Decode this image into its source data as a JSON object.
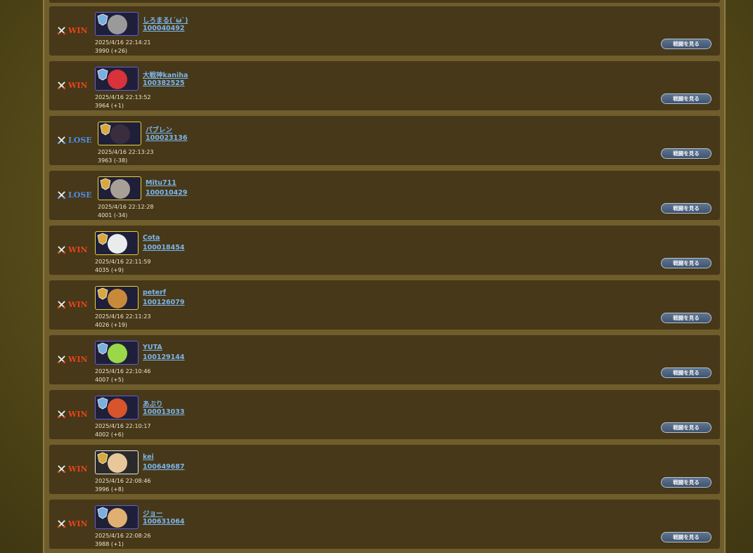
{
  "colors": {
    "win": "#e5431c",
    "lose": "#4f8fe8",
    "link": "#7cb5ec",
    "row_bg": "#463818"
  },
  "icons": {
    "result": "crossed-swords-icon",
    "rank": "rank-emblem-icon"
  },
  "battles": [
    {
      "result": "WIN",
      "name": "しろまる(´ω`)",
      "id": "100040492",
      "datetime": "2025/4/16 22:14:21",
      "rate": "3990 (+26)",
      "button": "戦闘を見る",
      "face_color": "#9a9a9a",
      "frame": "blue"
    },
    {
      "result": "WIN",
      "name": "大戦神kaniha",
      "id": "100382525",
      "datetime": "2025/4/16 22:13:52",
      "rate": "3964 (+1)",
      "button": "戦闘を見る",
      "face_color": "#d8323a",
      "frame": "blue"
    },
    {
      "result": "LOSE",
      "name": "パブレン",
      "id": "100023136",
      "datetime": "2025/4/16 22:13:23",
      "rate": "3963 (-38)",
      "button": "戦闘を見る",
      "face_color": "#3a2d3e",
      "frame": "gold"
    },
    {
      "result": "LOSE",
      "name": "Mitu711",
      "id": "100010429",
      "datetime": "2025/4/16 22:12:28",
      "rate": "4001 (-34)",
      "button": "戦闘を見る",
      "face_color": "#a8a096",
      "frame": "gold"
    },
    {
      "result": "WIN",
      "name": "Cota",
      "id": "100018454",
      "datetime": "2025/4/16 22:11:59",
      "rate": "4035 (+9)",
      "button": "戦闘を見る",
      "face_color": "#e8ecec",
      "frame": "gold"
    },
    {
      "result": "WIN",
      "name": "peterf",
      "id": "100126079",
      "datetime": "2025/4/16 22:11:23",
      "rate": "4026 (+19)",
      "button": "戦闘を見る",
      "face_color": "#c88a3a",
      "frame": "gold"
    },
    {
      "result": "WIN",
      "name": "YUTA",
      "id": "100129144",
      "datetime": "2025/4/16 22:10:46",
      "rate": "4007 (+5)",
      "button": "戦闘を見る",
      "face_color": "#9ad84a",
      "frame": "blue"
    },
    {
      "result": "WIN",
      "name": "あぶり",
      "id": "100013033",
      "datetime": "2025/4/16 22:10:17",
      "rate": "4002 (+6)",
      "button": "戦闘を見る",
      "face_color": "#d8542a",
      "frame": "blue"
    },
    {
      "result": "WIN",
      "name": "kei",
      "id": "100649687",
      "datetime": "2025/4/16 22:08:46",
      "rate": "3996 (+8)",
      "button": "戦闘を見る",
      "face_color": "#e8c89a",
      "frame": "white"
    },
    {
      "result": "WIN",
      "name": "ジョー",
      "id": "100631064",
      "datetime": "2025/4/16 22:08:26",
      "rate": "3988 (+1)",
      "button": "戦闘を見る",
      "face_color": "#e0b070",
      "frame": "blue"
    }
  ]
}
